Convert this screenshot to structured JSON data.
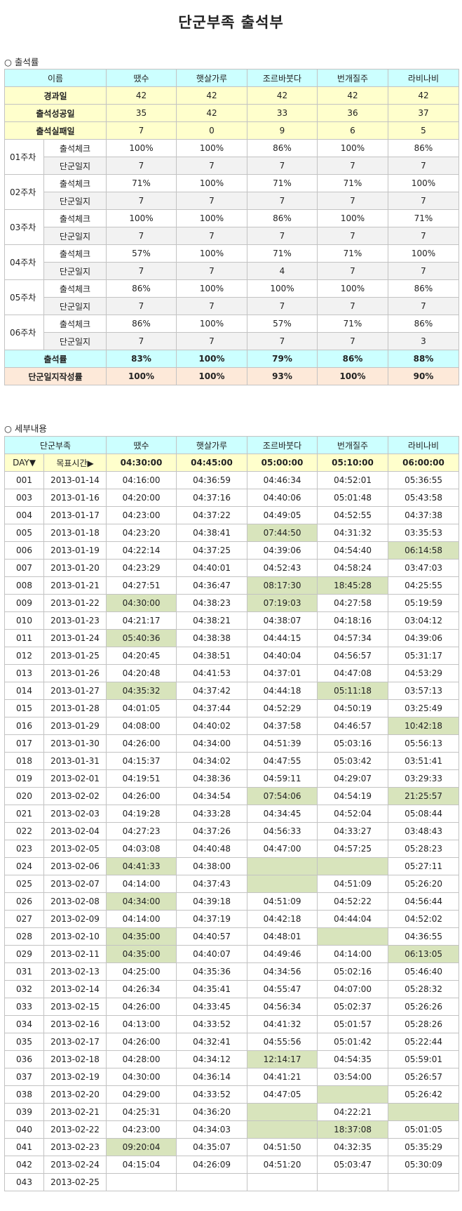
{
  "title": "단군부족 출석부",
  "section1": {
    "label": "○ 출석률",
    "header": [
      "이름",
      "땠수",
      "햇살가루",
      "조르바붓다",
      "번개질주",
      "라비나비"
    ],
    "summary": [
      {
        "label": "경과일",
        "values": [
          "42",
          "42",
          "42",
          "42",
          "42"
        ]
      },
      {
        "label": "출석성공일",
        "values": [
          "35",
          "42",
          "33",
          "36",
          "37"
        ]
      },
      {
        "label": "출석실패일",
        "values": [
          "7",
          "0",
          "9",
          "6",
          "5"
        ]
      }
    ],
    "weeks": [
      {
        "label": "01주차",
        "rows": [
          {
            "label": "출석체크",
            "values": [
              "100%",
              "100%",
              "86%",
              "100%",
              "86%"
            ]
          },
          {
            "label": "단군일지",
            "values": [
              "7",
              "7",
              "7",
              "7",
              "7"
            ]
          }
        ]
      },
      {
        "label": "02주차",
        "rows": [
          {
            "label": "출석체크",
            "values": [
              "71%",
              "100%",
              "71%",
              "71%",
              "100%"
            ]
          },
          {
            "label": "단군일지",
            "values": [
              "7",
              "7",
              "7",
              "7",
              "7"
            ]
          }
        ]
      },
      {
        "label": "03주차",
        "rows": [
          {
            "label": "출석체크",
            "values": [
              "100%",
              "100%",
              "86%",
              "100%",
              "71%"
            ]
          },
          {
            "label": "단군일지",
            "values": [
              "7",
              "7",
              "7",
              "7",
              "7"
            ]
          }
        ]
      },
      {
        "label": "04주차",
        "rows": [
          {
            "label": "출석체크",
            "values": [
              "57%",
              "100%",
              "71%",
              "71%",
              "100%"
            ]
          },
          {
            "label": "단군일지",
            "values": [
              "7",
              "7",
              "4",
              "7",
              "7"
            ]
          }
        ]
      },
      {
        "label": "05주차",
        "rows": [
          {
            "label": "출석체크",
            "values": [
              "86%",
              "100%",
              "100%",
              "100%",
              "86%"
            ]
          },
          {
            "label": "단군일지",
            "values": [
              "7",
              "7",
              "7",
              "7",
              "7"
            ]
          }
        ]
      },
      {
        "label": "06주차",
        "rows": [
          {
            "label": "출석체크",
            "values": [
              "86%",
              "100%",
              "57%",
              "71%",
              "86%"
            ]
          },
          {
            "label": "단군일지",
            "values": [
              "7",
              "7",
              "7",
              "7",
              "3"
            ]
          }
        ]
      }
    ],
    "rate": {
      "label": "출석률",
      "values": [
        "83%",
        "100%",
        "79%",
        "86%",
        "88%"
      ]
    },
    "journal": {
      "label": "단군일지작성률",
      "values": [
        "100%",
        "100%",
        "93%",
        "100%",
        "90%"
      ]
    }
  },
  "section2": {
    "label": "○ 세부내용",
    "header": [
      "단군부족",
      "땠수",
      "햇살가루",
      "조르바붓다",
      "번개질주",
      "라비나비"
    ],
    "subheader": {
      "day": "DAY▼",
      "target": "목표시간▶",
      "values": [
        "04:30:00",
        "04:45:00",
        "05:00:00",
        "05:10:00",
        "06:00:00"
      ]
    },
    "rows": [
      {
        "day": "001",
        "date": "2013-01-14",
        "times": [
          "04:16:00",
          "04:36:59",
          "04:46:34",
          "04:52:01",
          "05:36:55"
        ],
        "miss": []
      },
      {
        "day": "003",
        "date": "2013-01-16",
        "times": [
          "04:20:00",
          "04:37:16",
          "04:40:06",
          "05:01:48",
          "05:43:58"
        ],
        "miss": []
      },
      {
        "day": "004",
        "date": "2013-01-17",
        "times": [
          "04:23:00",
          "04:37:22",
          "04:49:05",
          "04:52:55",
          "04:37:38"
        ],
        "miss": []
      },
      {
        "day": "005",
        "date": "2013-01-18",
        "times": [
          "04:23:20",
          "04:38:41",
          "07:44:50",
          "04:31:32",
          "03:35:53"
        ],
        "miss": [
          2
        ]
      },
      {
        "day": "006",
        "date": "2013-01-19",
        "times": [
          "04:22:14",
          "04:37:25",
          "04:39:06",
          "04:54:40",
          "06:14:58"
        ],
        "miss": [
          4
        ]
      },
      {
        "day": "007",
        "date": "2013-01-20",
        "times": [
          "04:23:29",
          "04:40:01",
          "04:52:43",
          "04:58:24",
          "03:47:03"
        ],
        "miss": []
      },
      {
        "day": "008",
        "date": "2013-01-21",
        "times": [
          "04:27:51",
          "04:36:47",
          "08:17:30",
          "18:45:28",
          "04:25:55"
        ],
        "miss": [
          2,
          3
        ]
      },
      {
        "day": "009",
        "date": "2013-01-22",
        "times": [
          "04:30:00",
          "04:38:23",
          "07:19:03",
          "04:27:58",
          "05:19:59"
        ],
        "miss": [
          0,
          2
        ]
      },
      {
        "day": "010",
        "date": "2013-01-23",
        "times": [
          "04:21:17",
          "04:38:21",
          "04:38:07",
          "04:18:16",
          "03:04:12"
        ],
        "miss": []
      },
      {
        "day": "011",
        "date": "2013-01-24",
        "times": [
          "05:40:36",
          "04:38:38",
          "04:44:15",
          "04:57:34",
          "04:39:06"
        ],
        "miss": [
          0
        ]
      },
      {
        "day": "012",
        "date": "2013-01-25",
        "times": [
          "04:20:45",
          "04:38:51",
          "04:40:04",
          "04:56:57",
          "05:31:17"
        ],
        "miss": []
      },
      {
        "day": "013",
        "date": "2013-01-26",
        "times": [
          "04:20:48",
          "04:41:53",
          "04:37:01",
          "04:47:08",
          "04:53:29"
        ],
        "miss": []
      },
      {
        "day": "014",
        "date": "2013-01-27",
        "times": [
          "04:35:32",
          "04:37:42",
          "04:44:18",
          "05:11:18",
          "03:57:13"
        ],
        "miss": [
          0,
          3
        ]
      },
      {
        "day": "015",
        "date": "2013-01-28",
        "times": [
          "04:01:05",
          "04:37:44",
          "04:52:29",
          "04:50:19",
          "03:25:49"
        ],
        "miss": []
      },
      {
        "day": "016",
        "date": "2013-01-29",
        "times": [
          "04:08:00",
          "04:40:02",
          "04:37:58",
          "04:46:57",
          "10:42:18"
        ],
        "miss": [
          4
        ]
      },
      {
        "day": "017",
        "date": "2013-01-30",
        "times": [
          "04:26:00",
          "04:34:00",
          "04:51:39",
          "05:03:16",
          "05:56:13"
        ],
        "miss": []
      },
      {
        "day": "018",
        "date": "2013-01-31",
        "times": [
          "04:15:37",
          "04:34:02",
          "04:47:55",
          "05:03:42",
          "03:51:41"
        ],
        "miss": []
      },
      {
        "day": "019",
        "date": "2013-02-01",
        "times": [
          "04:19:51",
          "04:38:36",
          "04:59:11",
          "04:29:07",
          "03:29:33"
        ],
        "miss": []
      },
      {
        "day": "020",
        "date": "2013-02-02",
        "times": [
          "04:26:00",
          "04:34:54",
          "07:54:06",
          "04:54:19",
          "21:25:57"
        ],
        "miss": [
          2,
          4
        ]
      },
      {
        "day": "021",
        "date": "2013-02-03",
        "times": [
          "04:19:28",
          "04:33:28",
          "04:34:45",
          "04:52:04",
          "05:08:44"
        ],
        "miss": []
      },
      {
        "day": "022",
        "date": "2013-02-04",
        "times": [
          "04:27:23",
          "04:37:26",
          "04:56:33",
          "04:33:27",
          "03:48:43"
        ],
        "miss": []
      },
      {
        "day": "023",
        "date": "2013-02-05",
        "times": [
          "04:03:08",
          "04:40:48",
          "04:47:00",
          "04:57:25",
          "05:28:23"
        ],
        "miss": []
      },
      {
        "day": "024",
        "date": "2013-02-06",
        "times": [
          "04:41:33",
          "04:38:00",
          "",
          "",
          "05:27:11"
        ],
        "miss": [
          0,
          2,
          3
        ]
      },
      {
        "day": "025",
        "date": "2013-02-07",
        "times": [
          "04:14:00",
          "04:37:43",
          "",
          "04:51:09",
          "05:26:20"
        ],
        "miss": [
          2
        ]
      },
      {
        "day": "026",
        "date": "2013-02-08",
        "times": [
          "04:34:00",
          "04:39:18",
          "04:51:09",
          "04:52:22",
          "04:56:44"
        ],
        "miss": [
          0
        ]
      },
      {
        "day": "027",
        "date": "2013-02-09",
        "times": [
          "04:14:00",
          "04:37:19",
          "04:42:18",
          "04:44:04",
          "04:52:02"
        ],
        "miss": []
      },
      {
        "day": "028",
        "date": "2013-02-10",
        "times": [
          "04:35:00",
          "04:40:57",
          "04:48:01",
          "",
          "04:36:55"
        ],
        "miss": [
          0,
          3
        ]
      },
      {
        "day": "029",
        "date": "2013-02-11",
        "times": [
          "04:35:00",
          "04:40:07",
          "04:49:46",
          "04:14:00",
          "06:13:05"
        ],
        "miss": [
          0,
          4
        ]
      },
      {
        "day": "031",
        "date": "2013-02-13",
        "times": [
          "04:25:00",
          "04:35:36",
          "04:34:56",
          "05:02:16",
          "05:46:40"
        ],
        "miss": []
      },
      {
        "day": "032",
        "date": "2013-02-14",
        "times": [
          "04:26:34",
          "04:35:41",
          "04:55:47",
          "04:07:00",
          "05:28:32"
        ],
        "miss": []
      },
      {
        "day": "033",
        "date": "2013-02-15",
        "times": [
          "04:26:00",
          "04:33:45",
          "04:56:34",
          "05:02:37",
          "05:26:26"
        ],
        "miss": []
      },
      {
        "day": "034",
        "date": "2013-02-16",
        "times": [
          "04:13:00",
          "04:33:52",
          "04:41:32",
          "05:01:57",
          "05:28:26"
        ],
        "miss": []
      },
      {
        "day": "035",
        "date": "2013-02-17",
        "times": [
          "04:26:00",
          "04:32:41",
          "04:55:56",
          "05:01:42",
          "05:22:44"
        ],
        "miss": []
      },
      {
        "day": "036",
        "date": "2013-02-18",
        "times": [
          "04:28:00",
          "04:34:12",
          "12:14:17",
          "04:54:35",
          "05:59:01"
        ],
        "miss": [
          2
        ]
      },
      {
        "day": "037",
        "date": "2013-02-19",
        "times": [
          "04:30:00",
          "04:36:14",
          "04:41:21",
          "03:54:00",
          "05:26:57"
        ],
        "miss": []
      },
      {
        "day": "038",
        "date": "2013-02-20",
        "times": [
          "04:29:00",
          "04:33:52",
          "04:47:05",
          "",
          "05:26:42"
        ],
        "miss": [
          3
        ]
      },
      {
        "day": "039",
        "date": "2013-02-21",
        "times": [
          "04:25:31",
          "04:36:20",
          "",
          "04:22:21",
          ""
        ],
        "miss": [
          2,
          4
        ]
      },
      {
        "day": "040",
        "date": "2013-02-22",
        "times": [
          "04:23:00",
          "04:34:03",
          "",
          "18:37:08",
          "05:01:05"
        ],
        "miss": [
          2,
          3
        ]
      },
      {
        "day": "041",
        "date": "2013-02-23",
        "times": [
          "09:20:04",
          "04:35:07",
          "04:51:50",
          "04:32:35",
          "05:35:29"
        ],
        "miss": [
          0
        ]
      },
      {
        "day": "042",
        "date": "2013-02-24",
        "times": [
          "04:15:04",
          "04:26:09",
          "04:51:20",
          "05:03:47",
          "05:30:09"
        ],
        "miss": []
      },
      {
        "day": "043",
        "date": "2013-02-25",
        "times": [
          "",
          "",
          "",
          "",
          ""
        ],
        "miss": []
      }
    ]
  }
}
